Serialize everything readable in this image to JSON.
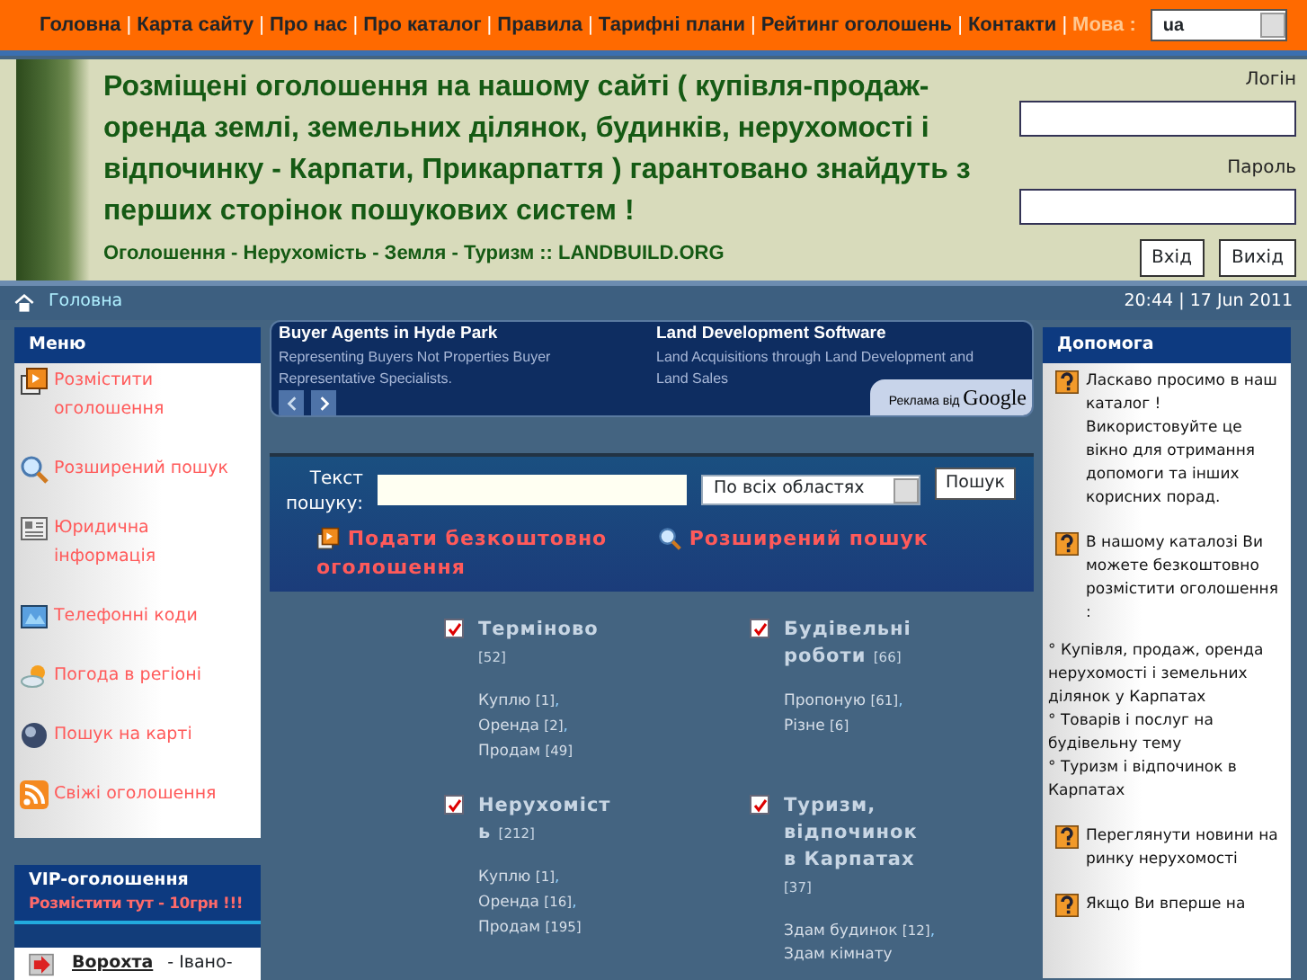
{
  "nav": {
    "entries": [
      {
        "kind": "link",
        "text": "Головна"
      },
      {
        "kind": "separator",
        "text": "|"
      },
      {
        "kind": "link",
        "text": "Карта сайту"
      },
      {
        "kind": "separator",
        "text": "|"
      },
      {
        "kind": "link",
        "text": "Про нас"
      },
      {
        "kind": "separator",
        "text": "|"
      },
      {
        "kind": "link",
        "text": "Про каталог"
      },
      {
        "kind": "separator",
        "text": "|"
      },
      {
        "kind": "link",
        "text": "Правила"
      },
      {
        "kind": "separator",
        "text": "|"
      },
      {
        "kind": "link",
        "text": "Тарифні плани"
      },
      {
        "kind": "separator",
        "text": "|"
      },
      {
        "kind": "link",
        "text": "Рейтинг оголошень"
      },
      {
        "kind": "separator",
        "text": "|"
      },
      {
        "kind": "link",
        "text": "Контакти"
      },
      {
        "kind": "separator",
        "text": "|"
      }
    ],
    "language_label": "Мова :",
    "language_value": "ua"
  },
  "header": {
    "headline": "Розміщені оголошення на нашому сайті ( купівля-продаж-оренда землі, земельних ділянок, будинків, нерухомості і відпочинку - Карпати, Прикарпаття ) гарантовано знайдуть з перших сторінок пошукових систем !",
    "tagline": "Оголошення - Нерухомість - Земля - Туризм :: LANDBUILD.ORG",
    "login_label": "Логін",
    "password_label": "Пароль",
    "buttons": [
      "Вхід",
      "Вихід"
    ]
  },
  "breadcrumb": {
    "home": "Головна",
    "datetime": "20:44 | 17 Jun 2011"
  },
  "menu": {
    "title": "Меню",
    "items": [
      {
        "label": "Розмістити оголошення",
        "kind": "post"
      },
      {
        "label": "Розширений пошук",
        "kind": "search"
      },
      {
        "label": "Юридична інформація",
        "kind": "legal"
      },
      {
        "label": "Телефонні коди",
        "kind": "phone"
      },
      {
        "label": "Погода в регіоні",
        "kind": "weather"
      },
      {
        "label": "Пошук на карті",
        "kind": "globe"
      },
      {
        "label": "Свіжі оголошення",
        "kind": "rss"
      }
    ]
  },
  "vip": {
    "title": "VIP-оголошення",
    "promo": "Розмістити тут - 10грн !!!",
    "listings": [
      {
        "link": "Ворохта",
        "text": "- Івано-"
      }
    ]
  },
  "ads": {
    "items": [
      {
        "title": "Buyer Agents in Hyde Park",
        "text": "Representing Buyers Not Properties Buyer Representative Specialists."
      },
      {
        "title": "Land Development Software",
        "text": "Land Acquisitions through Land Development and Land Sales"
      }
    ],
    "footer": "Реклама від",
    "brand": "Google"
  },
  "search": {
    "label": "Текст пошуку:",
    "region": "По всіх областях",
    "button": "Пошук",
    "links": [
      {
        "label": "Подати безкоштовно оголошення",
        "kind": "post"
      },
      {
        "label": "Розширений пошук",
        "kind": "search"
      }
    ]
  },
  "categories": [
    {
      "title": "Терміново",
      "count": "[52]",
      "checked": true,
      "subs": [
        {
          "label": "Куплю",
          "count": "[1]",
          "punct": ","
        },
        {
          "label": "Оренда",
          "count": "[2]",
          "punct": ","
        },
        {
          "label": "Продам",
          "count": "[49]"
        }
      ]
    },
    {
      "title": "Будівельні роботи",
      "count": "[66]",
      "checked": true,
      "subs": [
        {
          "label": "Пропоную",
          "count": "[61]",
          "punct": ","
        },
        {
          "label": "Різне",
          "count": "[6]"
        }
      ]
    },
    {
      "title": "Нерухомість",
      "count": "[212]",
      "checked": true,
      "subs": [
        {
          "label": "Куплю",
          "count": "[1]",
          "punct": ","
        },
        {
          "label": "Оренда",
          "count": "[16]",
          "punct": ","
        },
        {
          "label": "Продам",
          "count": "[195]"
        }
      ]
    },
    {
      "title": "Туризм, відпочинок в Карпатах",
      "count": "[37]",
      "checked": true,
      "subs": [
        {
          "label": "Здам будинок",
          "count": "[12]",
          "punct": ","
        },
        {
          "label": "Здам кімнату"
        }
      ]
    }
  ],
  "help": {
    "title": "Допомога",
    "items": [
      {
        "text": "Ласкаво просимо в наш каталог ! Використовуйте це вікно для отримання допомоги та інших корисних порад."
      },
      {
        "text": "В нашому каталозі Ви можете безкоштовно розмістити оголошення :",
        "bullets": [
          "° Купівля, продаж, оренда нерухомості і земельних ділянок у Карпатах",
          "° Товарів і послуг на будівельну тему",
          "° Туризм і відпочинок в Карпатах"
        ]
      },
      {
        "text": "Переглянути новини на ринку нерухомості"
      },
      {
        "text": "Якщо Ви вперше на"
      }
    ]
  }
}
